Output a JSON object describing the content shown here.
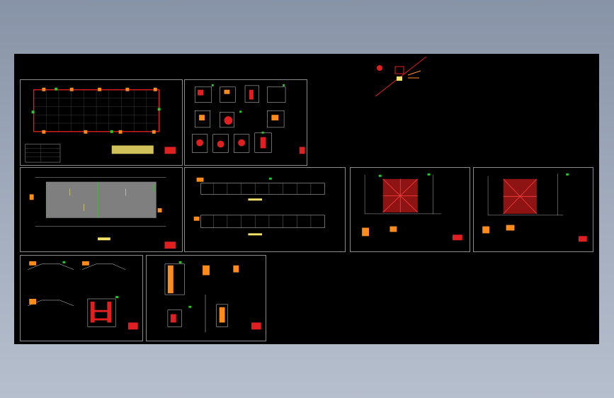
{
  "app": {
    "title": ""
  },
  "drawing": {
    "background_color": "#000000",
    "frame_color": "#8a8a8a",
    "accent_red": "#e02020",
    "accent_green": "#22cc22",
    "accent_orange": "#ff8c1a",
    "accent_yellow": "#f5e36a",
    "line_white": "#d8d8d8",
    "sheets": [
      {
        "id": "plan-columns",
        "kind": "floor-plan"
      },
      {
        "id": "details-1",
        "kind": "detail-sheet"
      },
      {
        "id": "roof-plan",
        "kind": "roof-plan"
      },
      {
        "id": "elevations",
        "kind": "elevation"
      },
      {
        "id": "frame-elev-1",
        "kind": "bracing-elevation"
      },
      {
        "id": "frame-elev-2",
        "kind": "bracing-elevation"
      },
      {
        "id": "sections-1",
        "kind": "section"
      },
      {
        "id": "details-2",
        "kind": "detail-sheet"
      }
    ]
  }
}
